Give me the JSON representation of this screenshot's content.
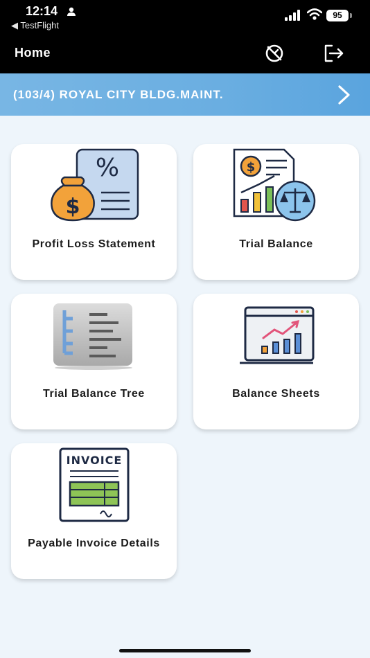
{
  "status_bar": {
    "time": "12:14",
    "back_app": "◀ TestFlight",
    "battery": "95"
  },
  "header": {
    "title": "Home"
  },
  "company_banner": {
    "label": "(103/4) ROYAL CITY BLDG.MAINT."
  },
  "menu": {
    "items": [
      {
        "label": "Profit Loss Statement",
        "icon": "profit-loss-icon"
      },
      {
        "label": "Trial Balance",
        "icon": "trial-balance-icon"
      },
      {
        "label": "Trial Balance Tree",
        "icon": "tree-icon"
      },
      {
        "label": "Balance Sheets",
        "icon": "balance-sheets-icon"
      },
      {
        "label": "Payable Invoice Details",
        "icon": "invoice-icon"
      }
    ]
  },
  "invoice_icon_text": "INVOICE",
  "colors": {
    "header_bg": "#000000",
    "banner": "#6aaee1",
    "page_bg": "#eef5fb"
  }
}
